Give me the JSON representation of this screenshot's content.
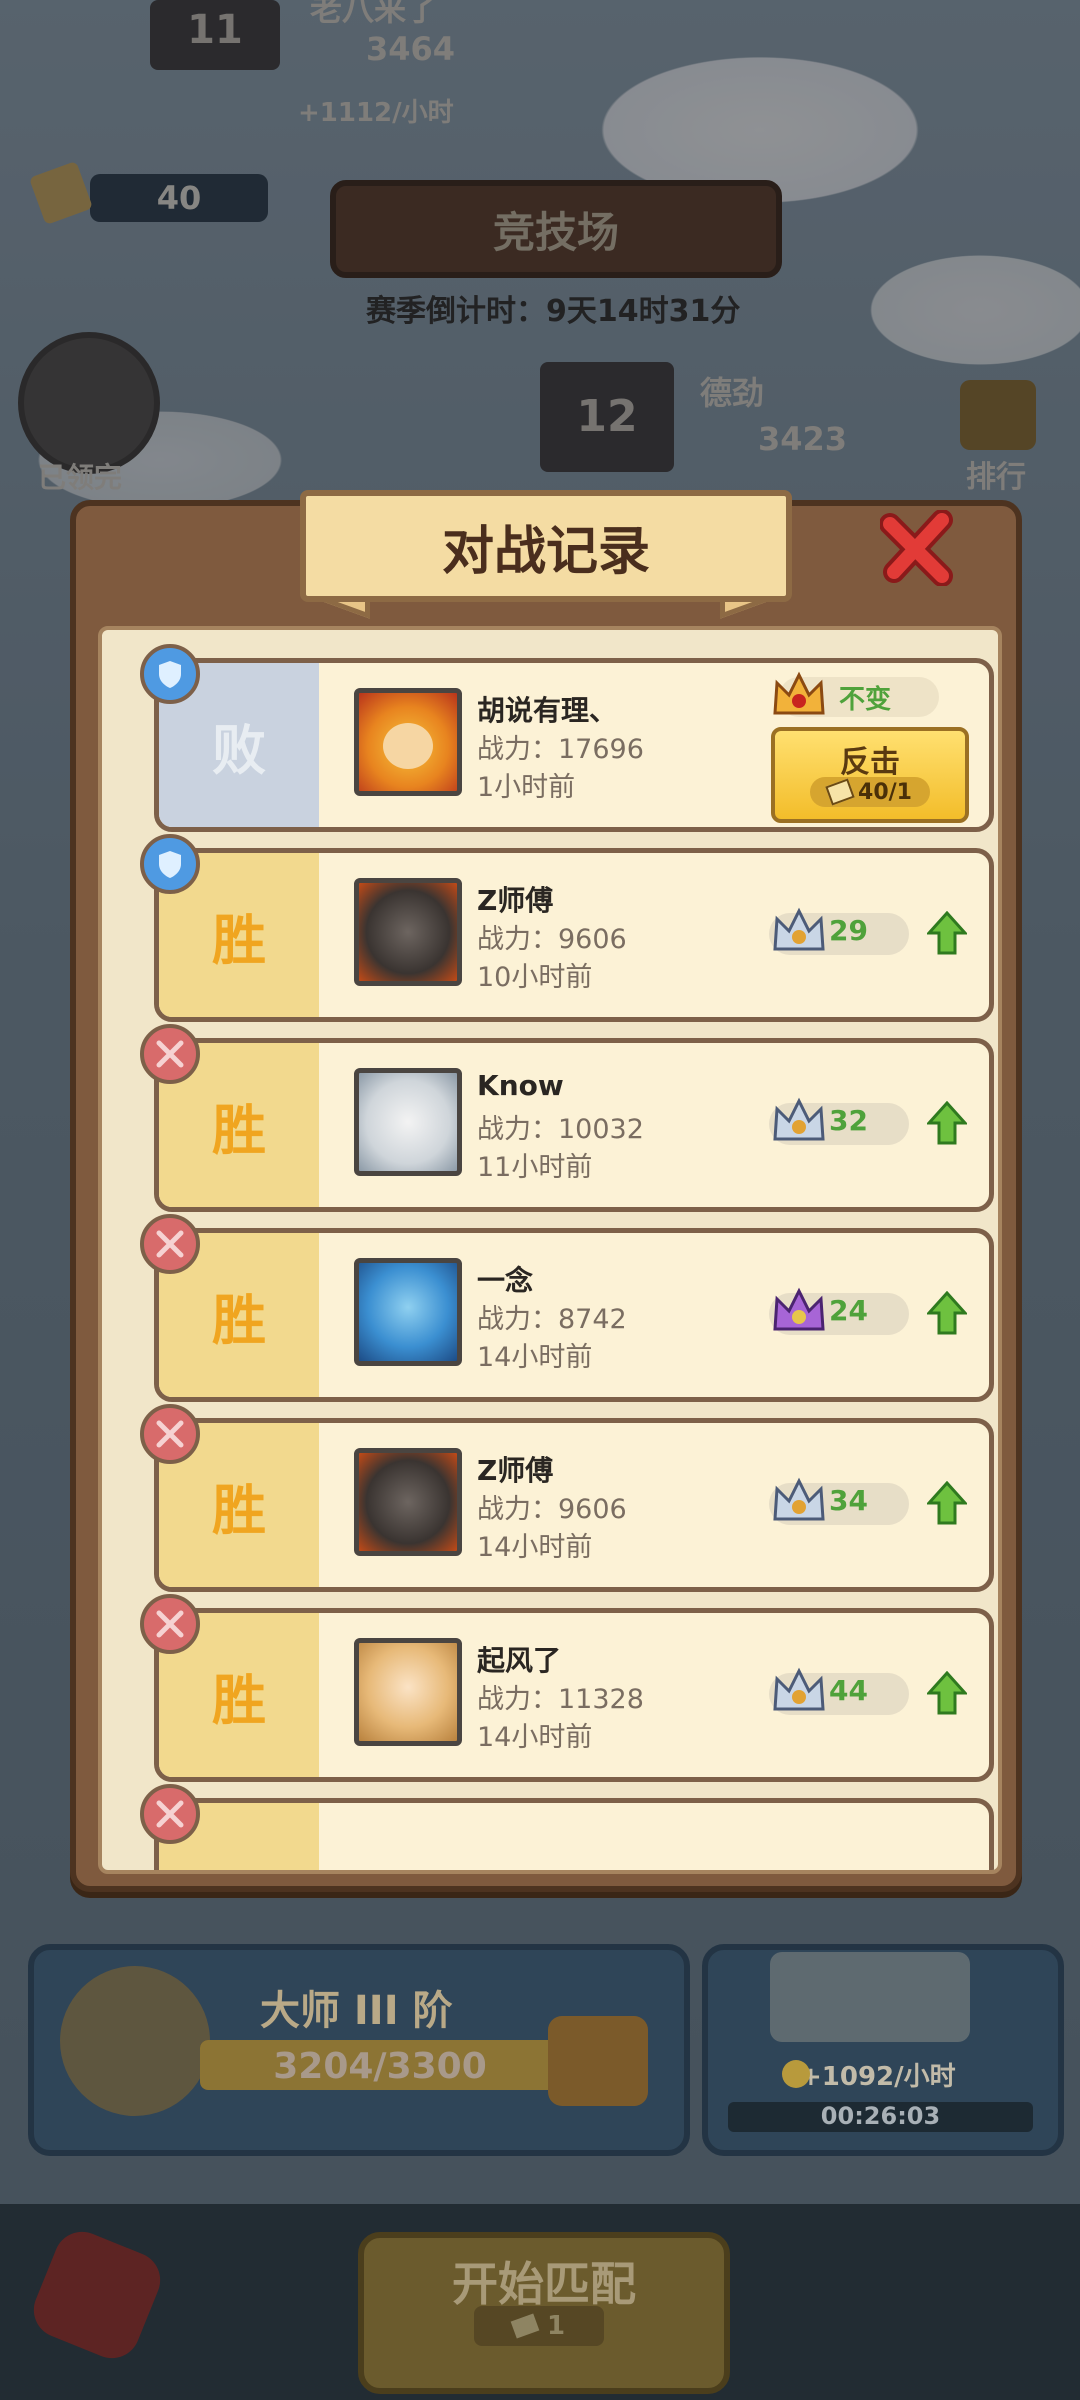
{
  "background": {
    "top_rank": "11",
    "top_player_name": "老八来了",
    "top_player_score": "3464",
    "top_income": "+1112/小时",
    "ticket_count": "40",
    "arena_title": "竞技场",
    "season_countdown": "赛季倒计时：9天14时31分",
    "claimed_label": "已领完",
    "rank12": "12",
    "rank12_name": "德劲",
    "rank12_score": "3423",
    "leaderboard_label": "排行"
  },
  "modal": {
    "title": "对战记录",
    "records": [
      {
        "result": "败",
        "name": "胡说有理、",
        "power_label": "战力：",
        "power": "17696",
        "time": "1小时前",
        "change": "不变",
        "revenge_label": "反击",
        "revenge_cost": "40/1",
        "mode": "defense",
        "rank_icon": "crown-gold-icon"
      },
      {
        "result": "胜",
        "name": "Z师傅",
        "power_label": "战力：",
        "power": "9606",
        "time": "10小时前",
        "change": "29",
        "mode": "defense",
        "rank_icon": "crown-silver-icon"
      },
      {
        "result": "胜",
        "name": "Know",
        "power_label": "战力：",
        "power": "10032",
        "time": "11小时前",
        "change": "32",
        "mode": "attack",
        "rank_icon": "crown-silver-icon"
      },
      {
        "result": "胜",
        "name": "一念",
        "power_label": "战力：",
        "power": "8742",
        "time": "14小时前",
        "change": "24",
        "mode": "attack",
        "rank_icon": "crown-purple-icon"
      },
      {
        "result": "胜",
        "name": "Z师傅",
        "power_label": "战力：",
        "power": "9606",
        "time": "14小时前",
        "change": "34",
        "mode": "attack",
        "rank_icon": "crown-silver-icon"
      },
      {
        "result": "胜",
        "name": "起风了",
        "power_label": "战力：",
        "power": "11328",
        "time": "14小时前",
        "change": "44",
        "mode": "attack",
        "rank_icon": "crown-silver-icon"
      }
    ]
  },
  "bottom": {
    "rank_title": "大师 III 阶",
    "progress_text": "3204/3300",
    "progress_fraction": 0.971,
    "income": "+1092/小时",
    "timer": "00:26:03",
    "start_label": "开始匹配",
    "start_cost": "1"
  },
  "colors": {
    "win_text": "#f0a520",
    "lose_text": "#e8edf2",
    "up_green": "#4fa23b",
    "panel_brown": "#7f5a3e"
  }
}
